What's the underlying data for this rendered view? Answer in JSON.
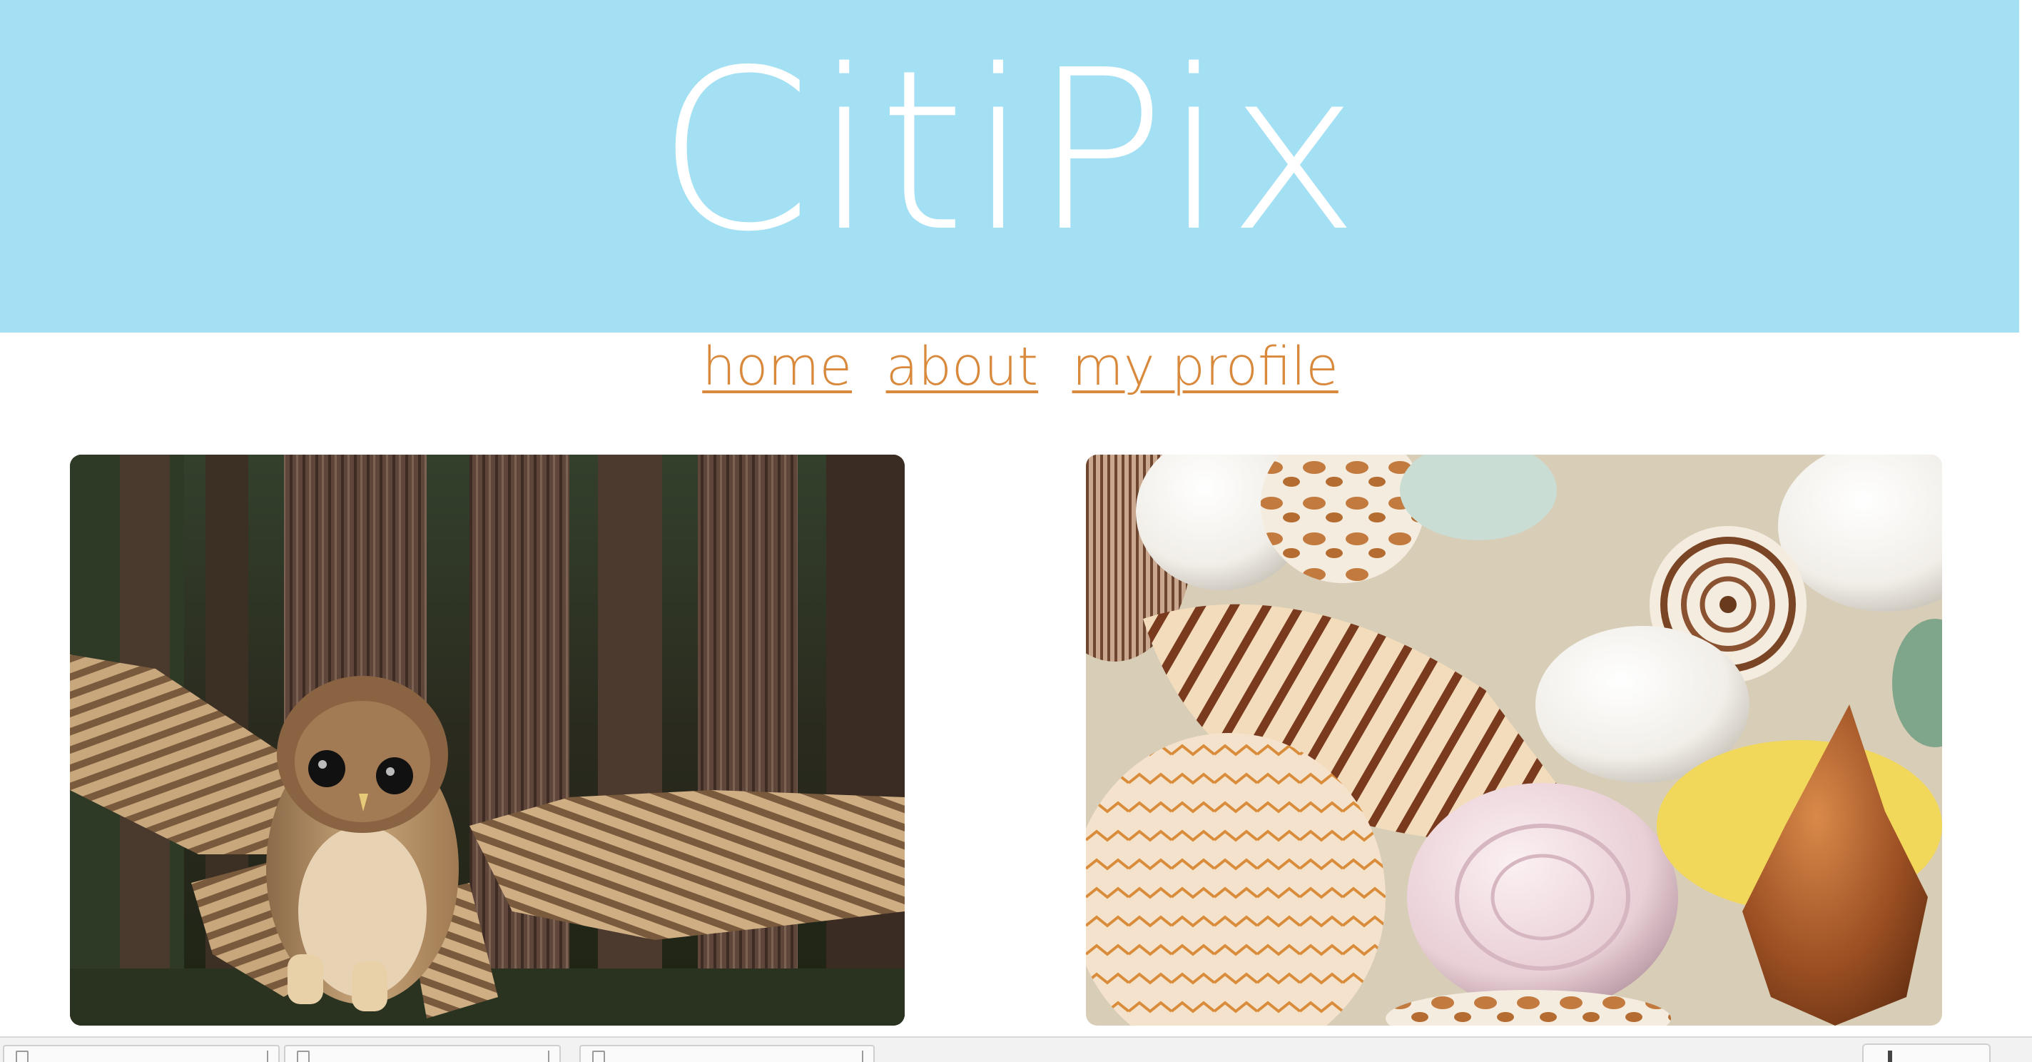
{
  "header": {
    "site_title": "CitiPix",
    "background_color": "#a4e0f3"
  },
  "nav": {
    "items": [
      {
        "label": "home"
      },
      {
        "label": "about"
      },
      {
        "label": "my profile"
      }
    ],
    "link_color": "#d9893c"
  },
  "gallery": {
    "photos": [
      {
        "subject": "owl-photo"
      },
      {
        "subject": "seashells-photo"
      }
    ]
  },
  "bottom_bar": {
    "tabs": [
      {
        "icon": "document-icon"
      },
      {
        "icon": "document-icon"
      },
      {
        "icon": "document-icon"
      }
    ],
    "right_button_icon": "download-icon"
  }
}
